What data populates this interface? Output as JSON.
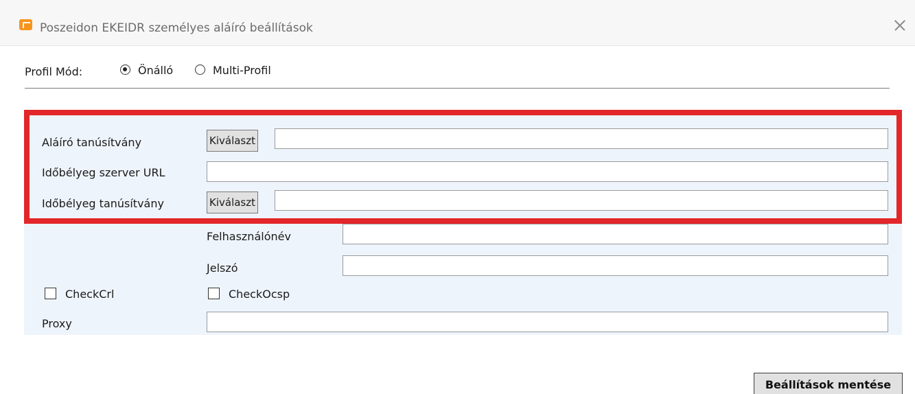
{
  "window": {
    "title": "Poszeidon EKEIDR személyes aláíró beállítások",
    "icon": "poszeidon-app-icon",
    "close_icon": "close-icon",
    "accent_color": "#f7941d"
  },
  "profile_mode": {
    "label": "Profil Mód:",
    "options": [
      {
        "label": "Önálló",
        "selected": true
      },
      {
        "label": "Multi-Profil",
        "selected": false
      }
    ]
  },
  "settings": {
    "highlight_color": "#e2262a",
    "signer_certificate": {
      "label": "Aláíró tanúsítvány",
      "button_label": "Kiválaszt",
      "value": ""
    },
    "timestamp_server_url": {
      "label": "Időbélyeg szerver URL",
      "value": ""
    },
    "timestamp_certificate": {
      "label": "Időbélyeg tanúsítvány",
      "button_label": "Kiválaszt",
      "value": ""
    },
    "username": {
      "label": "Felhasználónév",
      "value": ""
    },
    "password": {
      "label": "Jelszó",
      "value": ""
    },
    "check_crl": {
      "label": "CheckCrl",
      "checked": false
    },
    "check_ocsp": {
      "label": "CheckOcsp",
      "checked": false
    },
    "proxy": {
      "label": "Proxy",
      "value": ""
    }
  },
  "footer": {
    "save_label": "Beállítások mentése"
  }
}
